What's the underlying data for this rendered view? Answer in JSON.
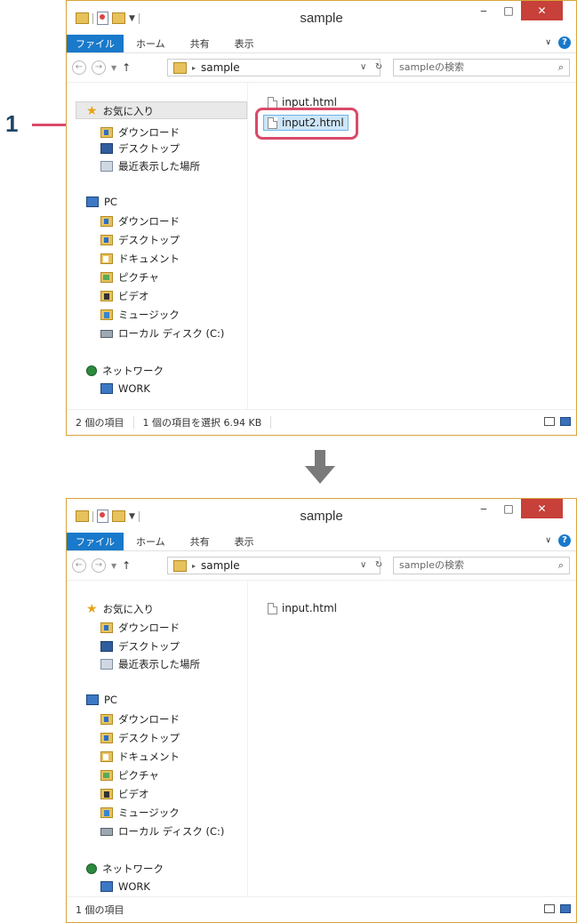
{
  "window_title": "sample",
  "ribbon": {
    "tab_file": "ファイル",
    "tab_home": "ホーム",
    "tab_share": "共有",
    "tab_view": "表示",
    "help": "?"
  },
  "address": {
    "path": "sample",
    "search_placeholder": "sampleの検索"
  },
  "nav": {
    "favorites": "お気に入り",
    "downloads": "ダウンロード",
    "desktop": "デスクトップ",
    "recent": "最近表示した場所",
    "pc": "PC",
    "pc_downloads": "ダウンロード",
    "pc_desktop": "デスクトップ",
    "documents": "ドキュメント",
    "pictures": "ピクチャ",
    "videos": "ビデオ",
    "music": "ミュージック",
    "local_disk": "ローカル ディスク (C:)",
    "network": "ネットワーク",
    "work": "WORK"
  },
  "before": {
    "files": [
      "input.html",
      "input2.html"
    ],
    "status_count": "2 個の項目",
    "status_selected": "1 個の項目を選択",
    "status_size": "6.94 KB"
  },
  "after": {
    "files": [
      "input.html"
    ],
    "status_count": "1 個の項目"
  },
  "callout": {
    "number": "1",
    "color": "#d94a6a"
  },
  "colors": {
    "accent": "#1979ca",
    "close": "#c7403a",
    "border": "#d7a43a"
  }
}
